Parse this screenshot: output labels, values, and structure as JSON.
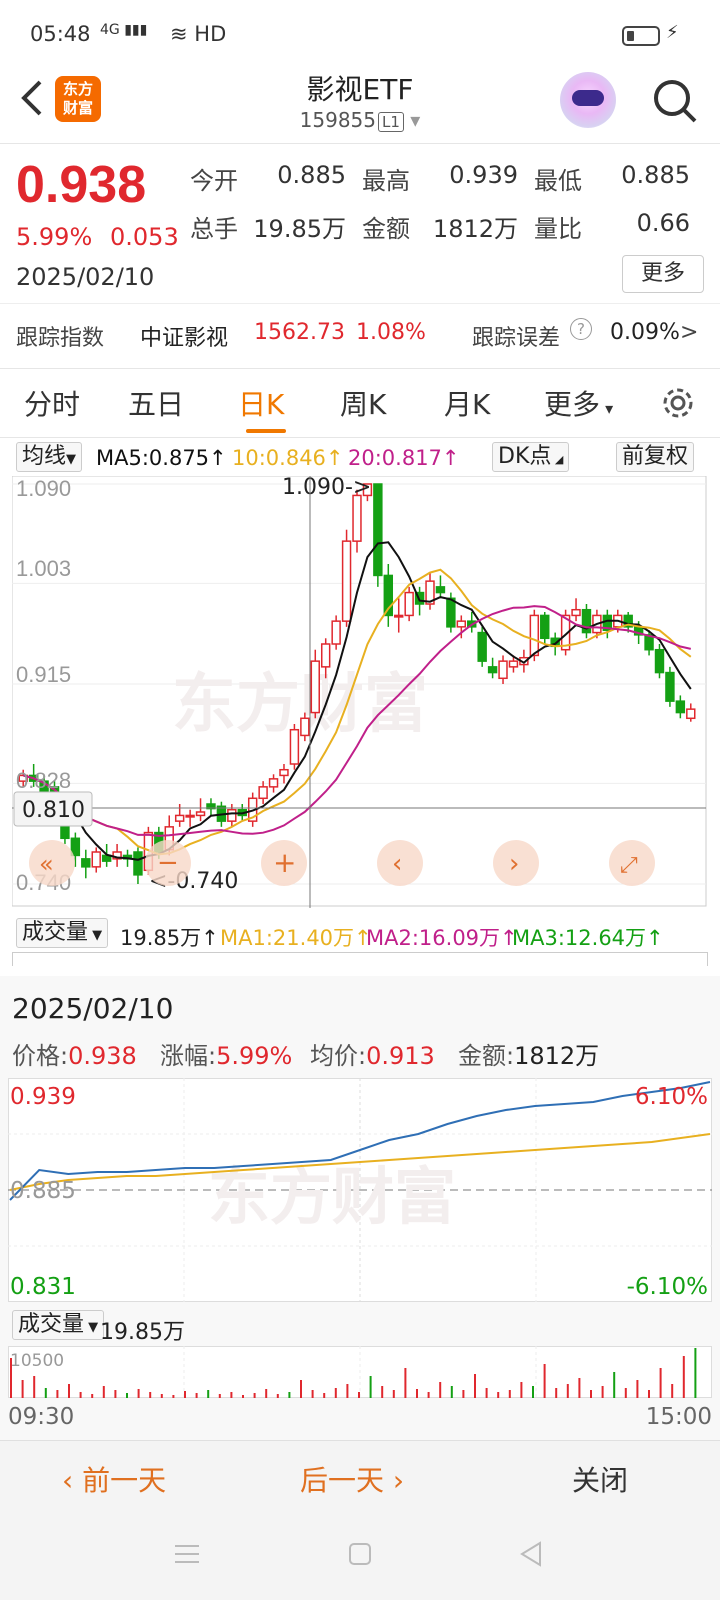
{
  "status": {
    "time": "05:48",
    "signal": "4G",
    "hd": "HD"
  },
  "header": {
    "title": "影视ETF",
    "code": "159855",
    "level": "L1",
    "logo_line1": "东方",
    "logo_line2": "财富"
  },
  "quote": {
    "price": "0.938",
    "pct": "5.99%",
    "change": "0.053",
    "date": "2025/02/10",
    "open_label": "今开",
    "open": "0.885",
    "high_label": "最高",
    "high": "0.939",
    "low_label": "最低",
    "low": "0.885",
    "volume_label": "总手",
    "volume": "19.85万",
    "amount_label": "金额",
    "amount": "1812万",
    "ratio_label": "量比",
    "ratio": "0.66",
    "more": "更多"
  },
  "tracking": {
    "label": "跟踪指数",
    "index": "中证影视",
    "index_value": "1562.73",
    "index_pct": "1.08%",
    "error_label": "跟踪误差",
    "error_value": "0.09%",
    "arrow": ">"
  },
  "tabs": [
    "分时",
    "五日",
    "日K",
    "周K",
    "月K",
    "更多"
  ],
  "kline_bar": {
    "ma_select": "均线",
    "ma5": "MA5:0.875↑",
    "ma10": "10:0.846↑",
    "ma20": "20:0.817↑",
    "dk": "DK点",
    "fq": "前复权"
  },
  "kline_axis": {
    "y1": "1.090",
    "y2": "1.003",
    "y3": "0.915",
    "y4": "0.828",
    "y5": "0.740",
    "high_mark": "1.090->",
    "low_mark": "<-0.740",
    "crosshair": "0.810"
  },
  "vol_bar": {
    "select": "成交量",
    "vol": "19.85万↑",
    "ma1": "MA1:21.40万↑",
    "ma2": "MA2:16.09万↑",
    "ma3": "MA3:12.64万↑"
  },
  "detail": {
    "date": "2025/02/10",
    "price_label": "价格:",
    "price": "0.938",
    "pct_label": "涨幅:",
    "pct": "5.99%",
    "avg_label": "均价:",
    "avg": "0.913",
    "amt_label": "金额:",
    "amt": "1812万",
    "top_left": "0.939",
    "mid_left": "0.885",
    "bot_left": "0.831",
    "top_right": "6.10%",
    "bot_right": "-6.10%",
    "vol_select": "成交量",
    "vol_value": "19.85万",
    "vol_scale": "10500",
    "time_start": "09:30",
    "time_end": "15:00"
  },
  "bottom": {
    "prev": "前一天",
    "next": "后一天",
    "close": "关闭"
  },
  "colors": {
    "up": "#e0282e",
    "down": "#14a014",
    "accent": "#f07800",
    "ma5": "#111111",
    "ma10": "#e8b020",
    "ma20": "#c0208a",
    "price_line": "#2f6fb5",
    "avg_line": "#e8b020"
  },
  "chart_data": [
    {
      "type": "candlestick",
      "title": "",
      "ylim": [
        0.74,
        1.09
      ],
      "y_ticks": [
        1.09,
        1.003,
        0.915,
        0.828,
        0.74
      ],
      "candles": [
        [
          0.83,
          0.835,
          0.84,
          0.825
        ],
        [
          0.835,
          0.83,
          0.845,
          0.825
        ],
        [
          0.83,
          0.82,
          0.835,
          0.815
        ],
        [
          0.825,
          0.805,
          0.83,
          0.8
        ],
        [
          0.81,
          0.78,
          0.815,
          0.775
        ],
        [
          0.78,
          0.765,
          0.785,
          0.755
        ],
        [
          0.762,
          0.755,
          0.77,
          0.745
        ],
        [
          0.755,
          0.768,
          0.772,
          0.75
        ],
        [
          0.765,
          0.76,
          0.775,
          0.755
        ],
        [
          0.762,
          0.768,
          0.775,
          0.755
        ],
        [
          0.765,
          0.762,
          0.77,
          0.755
        ],
        [
          0.768,
          0.748,
          0.772,
          0.74
        ],
        [
          0.752,
          0.785,
          0.79,
          0.748
        ],
        [
          0.785,
          0.768,
          0.79,
          0.762
        ],
        [
          0.77,
          0.79,
          0.8,
          0.765
        ],
        [
          0.795,
          0.8,
          0.81,
          0.79
        ],
        [
          0.8,
          0.8,
          0.805,
          0.79
        ],
        [
          0.8,
          0.803,
          0.815,
          0.795
        ],
        [
          0.81,
          0.806,
          0.815,
          0.8
        ],
        [
          0.808,
          0.795,
          0.812,
          0.79
        ],
        [
          0.795,
          0.805,
          0.81,
          0.79
        ],
        [
          0.805,
          0.8,
          0.81,
          0.795
        ],
        [
          0.795,
          0.815,
          0.82,
          0.79
        ],
        [
          0.815,
          0.825,
          0.83,
          0.81
        ],
        [
          0.825,
          0.832,
          0.836,
          0.82
        ],
        [
          0.835,
          0.84,
          0.845,
          0.828
        ],
        [
          0.845,
          0.875,
          0.88,
          0.84
        ],
        [
          0.87,
          0.885,
          0.89,
          0.865
        ],
        [
          0.89,
          0.935,
          0.945,
          0.885
        ],
        [
          0.93,
          0.95,
          0.955,
          0.92
        ],
        [
          0.95,
          0.97,
          0.975,
          0.945
        ],
        [
          0.97,
          1.04,
          1.05,
          0.965
        ],
        [
          1.04,
          1.08,
          1.085,
          1.03
        ],
        [
          1.08,
          1.09,
          1.09,
          1.075
        ],
        [
          1.09,
          1.01,
          1.09,
          1.0
        ],
        [
          1.01,
          0.975,
          1.02,
          0.965
        ],
        [
          0.975,
          0.975,
          0.99,
          0.96
        ],
        [
          0.975,
          0.995,
          1.0,
          0.97
        ],
        [
          0.995,
          0.985,
          1.0,
          0.975
        ],
        [
          0.985,
          1.005,
          1.012,
          0.98
        ],
        [
          1.0,
          0.995,
          1.01,
          0.99
        ],
        [
          0.99,
          0.965,
          0.995,
          0.96
        ],
        [
          0.965,
          0.97,
          0.975,
          0.955
        ],
        [
          0.97,
          0.965,
          0.978,
          0.96
        ],
        [
          0.96,
          0.935,
          0.965,
          0.93
        ],
        [
          0.93,
          0.925,
          0.938,
          0.92
        ],
        [
          0.92,
          0.935,
          0.94,
          0.915
        ],
        [
          0.93,
          0.935,
          0.94,
          0.925
        ],
        [
          0.932,
          0.938,
          0.945,
          0.925
        ],
        [
          0.94,
          0.975,
          0.98,
          0.935
        ],
        [
          0.975,
          0.955,
          0.978,
          0.95
        ],
        [
          0.955,
          0.948,
          0.96,
          0.94
        ],
        [
          0.945,
          0.975,
          0.98,
          0.94
        ],
        [
          0.975,
          0.98,
          0.99,
          0.97
        ],
        [
          0.98,
          0.96,
          0.985,
          0.955
        ],
        [
          0.96,
          0.975,
          0.98,
          0.955
        ],
        [
          0.975,
          0.962,
          0.98,
          0.955
        ],
        [
          0.965,
          0.975,
          0.98,
          0.96
        ],
        [
          0.975,
          0.965,
          0.978,
          0.96
        ],
        [
          0.965,
          0.958,
          0.97,
          0.95
        ],
        [
          0.958,
          0.945,
          0.962,
          0.94
        ],
        [
          0.945,
          0.925,
          0.95,
          0.92
        ],
        [
          0.925,
          0.9,
          0.93,
          0.895
        ],
        [
          0.9,
          0.89,
          0.905,
          0.885
        ],
        [
          0.885,
          0.893,
          0.898,
          0.882
        ]
      ]
    },
    {
      "type": "line",
      "title": "",
      "ylim": [
        0.831,
        0.939
      ],
      "series": [
        {
          "values": [
            0.88,
            0.895,
            0.893,
            0.894,
            0.894,
            0.895,
            0.896,
            0.896,
            0.897,
            0.898,
            0.899,
            0.9,
            0.905,
            0.91,
            0.913,
            0.918,
            0.922,
            0.925,
            0.927,
            0.928,
            0.929,
            0.932,
            0.934,
            0.936,
            0.939
          ]
        },
        {
          "values": [
            0.885,
            0.888,
            0.89,
            0.891,
            0.892,
            0.892,
            0.893,
            0.894,
            0.895,
            0.896,
            0.897,
            0.898,
            0.899,
            0.9,
            0.901,
            0.902,
            0.903,
            0.904,
            0.905,
            0.906,
            0.907,
            0.908,
            0.909,
            0.911,
            0.913
          ]
        }
      ]
    }
  ]
}
